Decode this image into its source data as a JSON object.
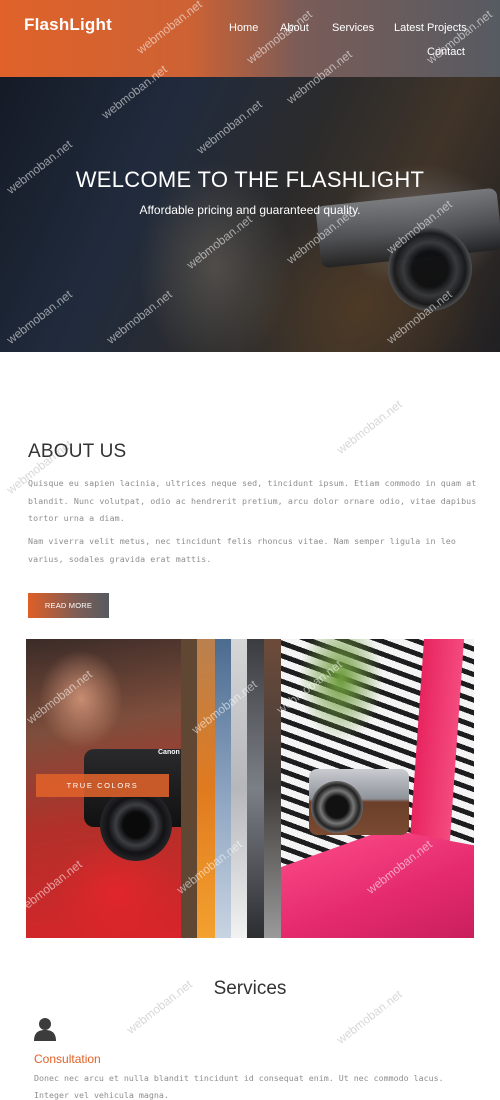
{
  "brand": "FlashLight",
  "nav": [
    {
      "label": "Home"
    },
    {
      "label": "About"
    },
    {
      "label": "Services"
    },
    {
      "label": "Latest Projects"
    },
    {
      "label": "Contact"
    }
  ],
  "hero": {
    "title": "WELCOME TO THE FLASHLIGHT",
    "subtitle": "Affordable pricing and guaranteed quality."
  },
  "about": {
    "title": "ABOUT US",
    "paragraphs": [
      "Quisque eu sapien lacinia, ultrices neque sed, tincidunt ipsum. Etiam commodo in quam at blandit. Nunc volutpat, odio ac hendrerit pretium, arcu dolor ornare odio, vitae dapibus tortor urna a diam.",
      "Nam viverra velit metus, nec tincidunt felis rhoncus vitae. Nam semper ligula in leo varius, sodales gravida erat mattis."
    ],
    "read_more": "READ MORE"
  },
  "gallery": {
    "badge": "TRUE COLORS",
    "camera_brand": "Canon"
  },
  "services": {
    "title": "Services",
    "items": [
      {
        "name": "Consultation",
        "description": "Donec nec arcu et nulla blandit tincidunt id consequat enim. Ut nec commodo lacus. Integer vel vehicula magna.",
        "icon": "user-icon"
      }
    ]
  },
  "watermark": "webmoban.net",
  "colors": {
    "accent": "#e0622a",
    "header_gradient_end": "#565b62",
    "text_gray": "#8e8e8e",
    "heading": "#333333"
  }
}
